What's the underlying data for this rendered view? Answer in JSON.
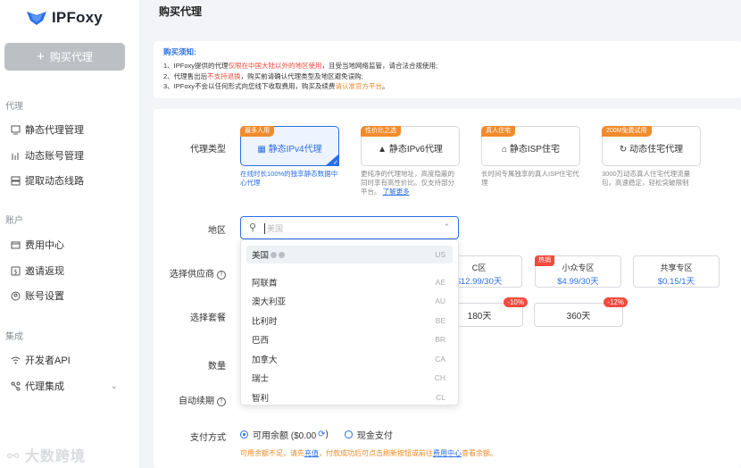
{
  "app": {
    "name": "IPFoxy"
  },
  "sidebar": {
    "buy_button": "购买代理",
    "sections": [
      {
        "title": "代理",
        "items": [
          "静态代理管理",
          "动态账号管理",
          "提取动态线路"
        ]
      },
      {
        "title": "账户",
        "items": [
          "费用中心",
          "邀请返现",
          "账号设置"
        ]
      },
      {
        "title": "集成",
        "items": [
          "开发者API",
          "代理集成"
        ]
      }
    ]
  },
  "watermark": "大数跨境",
  "page": {
    "title": "购买代理"
  },
  "notice": {
    "title": "购买须知:",
    "line1": {
      "a": "1、IPFoxy提供的代理",
      "red": "仅限在中国大陆以外的地区使用",
      "b": "，且受当地网络监管，请合法合规使用;"
    },
    "line2": {
      "a": "2、代理售出后",
      "red": "不支持退换",
      "b": "，购买前请确认代理类型及地区避免误购;"
    },
    "line3": {
      "a": "3、IPFoxy不会以任何形式向您线下收取费用，购买及续费",
      "orange": "请认准官方平台",
      "b": "。"
    }
  },
  "form": {
    "labels": {
      "proxy_type": "代理类型",
      "region": "地区",
      "supplier": "选择供应商",
      "package": "选择套餐",
      "quantity": "数量",
      "auto_renew": "自动续期",
      "payment": "支付方式"
    },
    "proxy_types": [
      {
        "tag": "最多人用",
        "name": "静态IPv4代理",
        "desc": "在线时长100%的独享静态数据中心代理",
        "more": ""
      },
      {
        "tag": "性价比之选",
        "name": "静态IPv6代理",
        "desc": "更纯净的代理地址，高度隐蔽的同时享有高性价比。仅支持部分平台。",
        "more": "了解更多"
      },
      {
        "tag": "真人住宅",
        "name": "静态ISP住宅",
        "desc": "长时间专属独享的真人ISP住宅代理",
        "more": ""
      },
      {
        "tag": "200M免费试用",
        "name": "动态住宅代理",
        "desc": "3000万动态真人住宅代理流量包，高速稳定，轻松突破限制",
        "more": ""
      }
    ],
    "region_placeholder": "美国",
    "region_options": [
      {
        "name": "美国",
        "code": "US"
      },
      {
        "name": "阿联酋",
        "code": "AE"
      },
      {
        "name": "澳大利亚",
        "code": "AU"
      },
      {
        "name": "比利时",
        "code": "BE"
      },
      {
        "name": "巴西",
        "code": "BR"
      },
      {
        "name": "加拿大",
        "code": "CA"
      },
      {
        "name": "瑞士",
        "code": "CH"
      },
      {
        "name": "智利",
        "code": "CL"
      }
    ],
    "suppliers": [
      {
        "name": "C区",
        "price": "$12.99/30天",
        "hot": ""
      },
      {
        "name": "小众专区",
        "price": "$4.99/30天",
        "hot": "热销"
      },
      {
        "name": "共享专区",
        "price": "$0.15/1天",
        "hot": ""
      }
    ],
    "packages": [
      {
        "label": "180天",
        "discount": "-10%"
      },
      {
        "label": "360天",
        "discount": "-12%"
      }
    ],
    "payment": {
      "balance_label": "可用余额 ($0.00",
      "balance_close": ")",
      "cash_label": "现金支付",
      "note_a": "可用余额不足，请先",
      "note_link1": "充值",
      "note_b": "，付款成功后可点击刷新按钮或前往",
      "note_link2": "费用中心",
      "note_c": "查看余额。"
    }
  },
  "colors": {
    "accent": "#2a6fe8",
    "warning": "#f08a24",
    "danger": "#f24a3d"
  }
}
